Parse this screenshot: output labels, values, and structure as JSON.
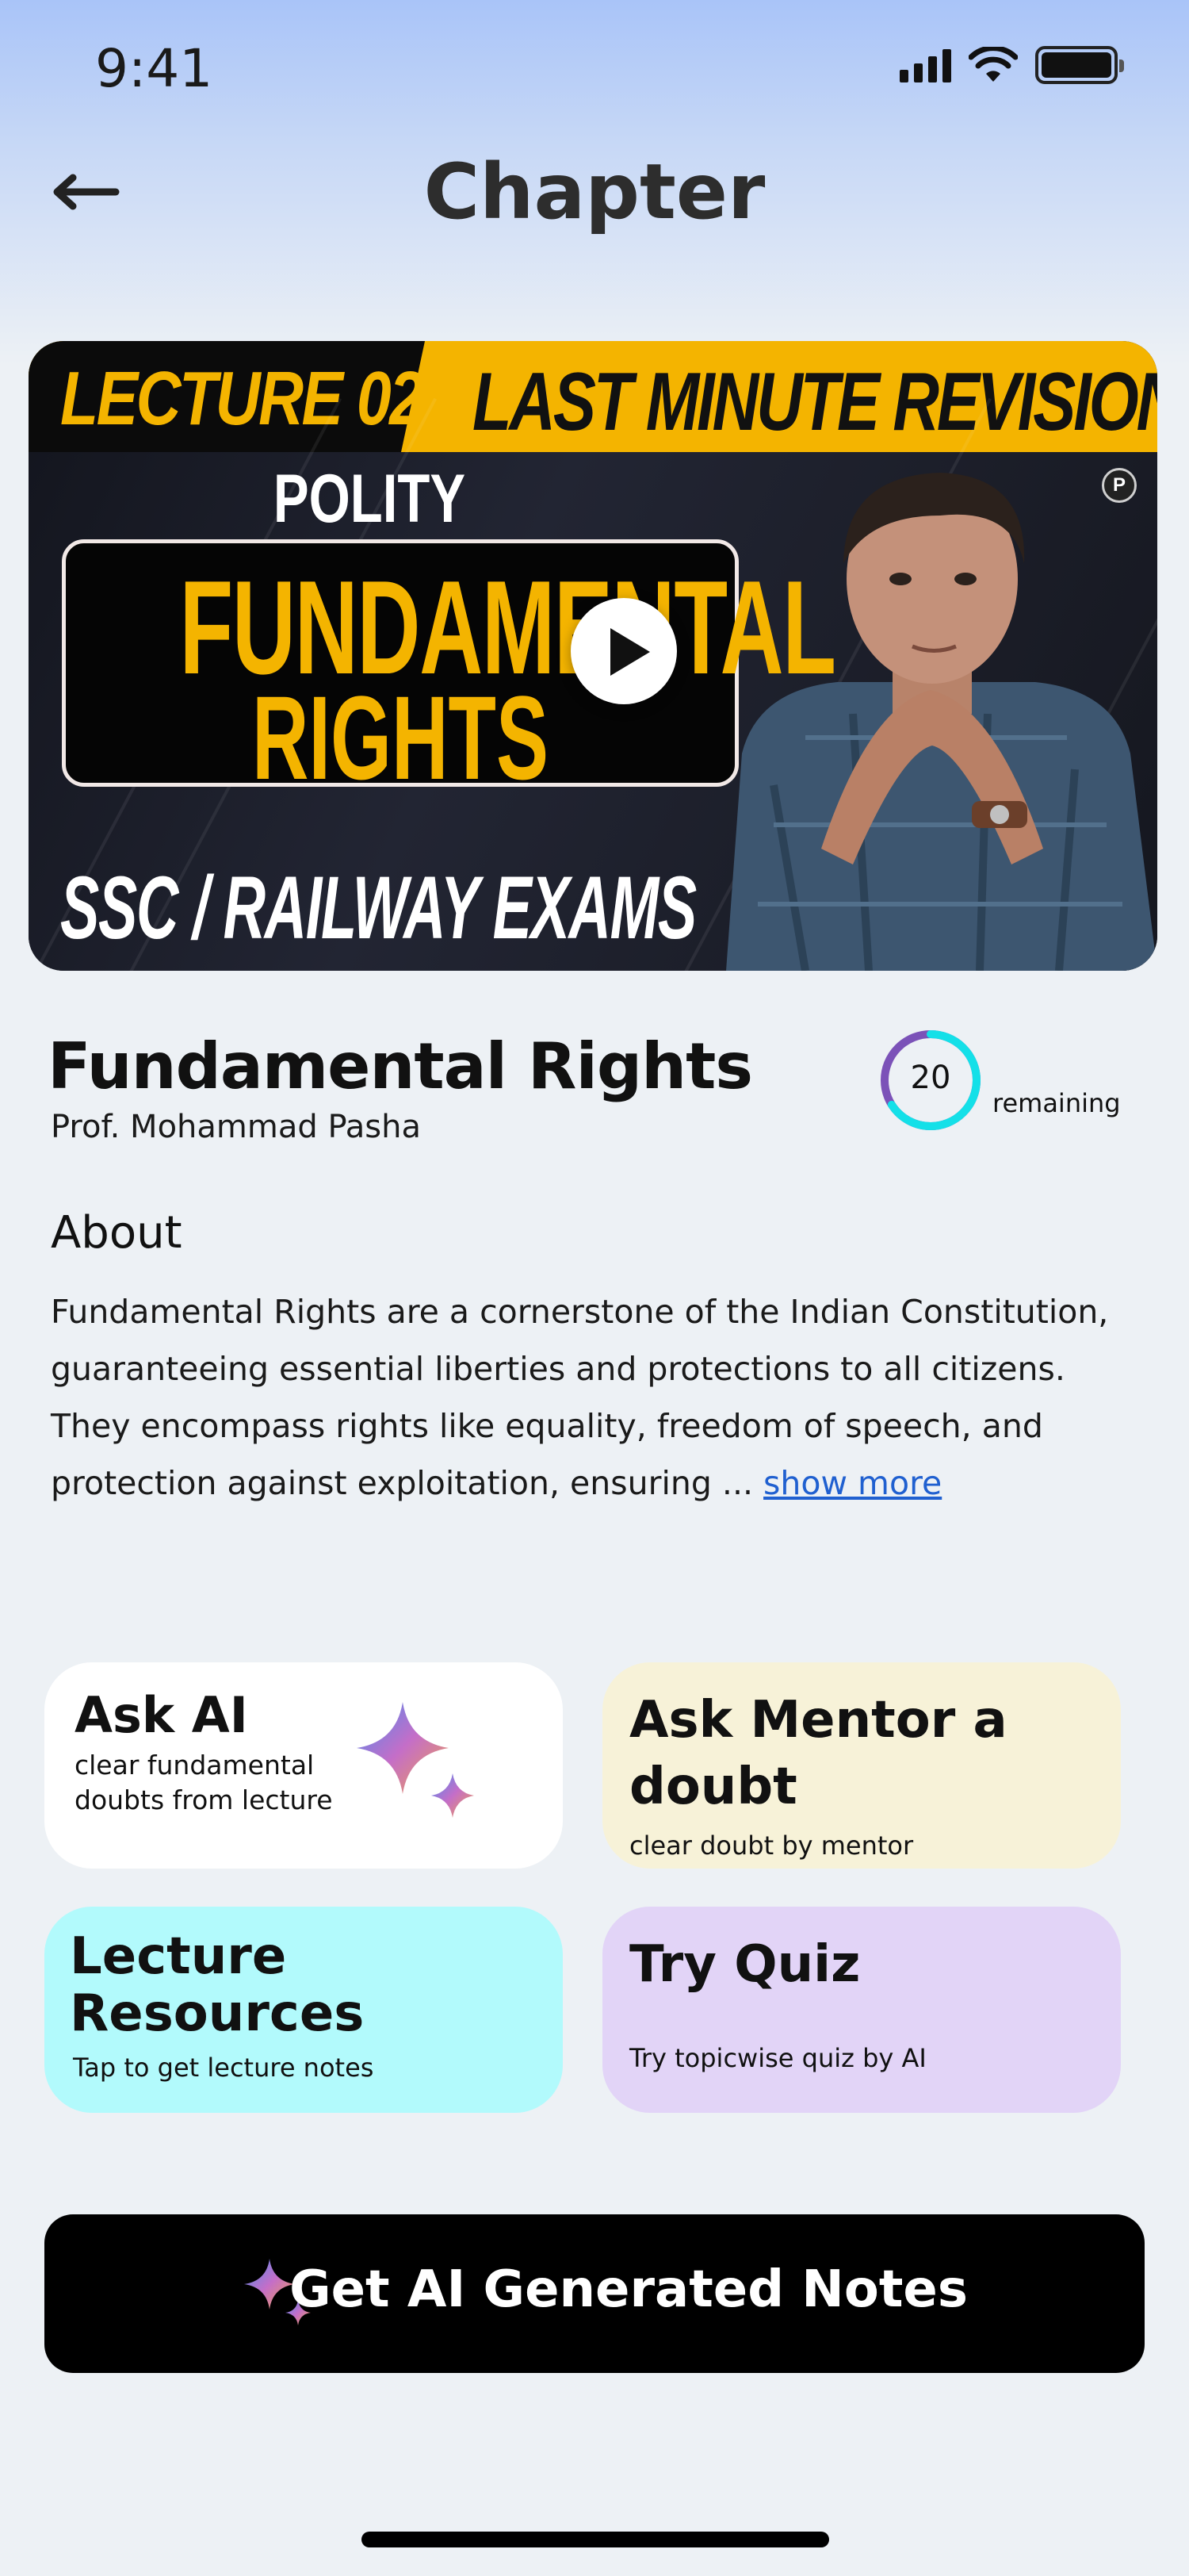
{
  "status": {
    "time": "9:41"
  },
  "header": {
    "title": "Chapter",
    "back_icon": "arrow-left-icon"
  },
  "video": {
    "banner_left": "LECTURE 02",
    "banner_right": "LAST MINUTE REVISION",
    "subject": "POLITY",
    "topic_line1": "FUNDAMENTAL",
    "topic_line2": "RIGHTS",
    "exam": "SSC / RAILWAY EXAMS",
    "channel_logo": "P"
  },
  "lecture": {
    "title": "Fundamental Rights",
    "author": "Prof. Mohammad Pasha",
    "remaining_count": "20",
    "remaining_label": "remaining",
    "remaining_fraction": 0.66
  },
  "about": {
    "heading": "About",
    "text": "Fundamental Rights are a cornerstone of the Indian Constitution, guaranteeing essential liberties and protections to all citizens. They encompass rights like equality, freedom of speech, and protection against exploitation, ensuring ... ",
    "show_more": "show more"
  },
  "cards": {
    "ask_ai": {
      "title": "Ask AI",
      "sub_line1": "clear fundamental",
      "sub_line2": "doubts from lecture"
    },
    "mentor": {
      "title_line1": "Ask Mentor a",
      "title_line2": "doubt",
      "sub": "clear doubt by mentor"
    },
    "resources": {
      "title_line1": "Lecture",
      "title_line2": "Resources",
      "sub": "Tap to get lecture notes"
    },
    "quiz": {
      "title": "Try Quiz",
      "sub": "Try topicwise quiz by AI"
    }
  },
  "cta": {
    "label": "Get AI Generated Notes",
    "icon": "sparkle-icon"
  },
  "colors": {
    "accent_yellow": "#f4b400",
    "progress_cyan": "#14e0e8",
    "progress_purple": "#7b52b8",
    "link_blue": "#2060d0"
  }
}
